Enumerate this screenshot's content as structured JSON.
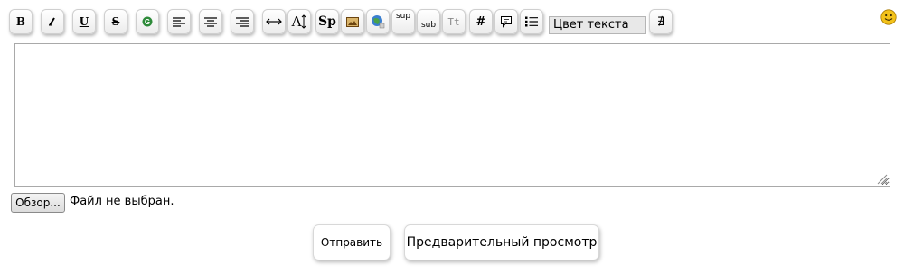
{
  "toolbar": {
    "buttons": [
      {
        "id": "bold",
        "label": "B",
        "icon": "bold-icon"
      },
      {
        "id": "italic",
        "icon": "italic-icon"
      },
      {
        "id": "underline",
        "label": "U",
        "icon": "underline-icon"
      },
      {
        "id": "strike",
        "label": "S",
        "icon": "strikethrough-icon"
      },
      {
        "id": "google",
        "label": "G",
        "icon": "google-icon"
      },
      {
        "id": "align-left",
        "icon": "align-left-icon"
      },
      {
        "id": "align-center",
        "icon": "align-center-icon"
      },
      {
        "id": "align-right",
        "icon": "align-right-icon"
      },
      {
        "id": "justify",
        "icon": "horizontal-arrows-icon"
      },
      {
        "id": "font-size",
        "label": "A",
        "icon": "font-size-icon"
      },
      {
        "id": "spoiler",
        "label": "Sp",
        "icon": "spoiler-icon"
      },
      {
        "id": "image",
        "icon": "image-icon"
      },
      {
        "id": "link",
        "icon": "globe-link-icon"
      },
      {
        "id": "sup",
        "label": "sup",
        "icon": "superscript-icon"
      },
      {
        "id": "sub",
        "label": "sub",
        "icon": "subscript-icon"
      },
      {
        "id": "typewriter",
        "label": "Tt",
        "icon": "typewriter-icon"
      },
      {
        "id": "code",
        "label": "#",
        "icon": "hash-icon"
      },
      {
        "id": "quote",
        "icon": "speech-bubble-icon"
      },
      {
        "id": "list",
        "icon": "bulleted-list-icon"
      }
    ],
    "color_select_value": "Цвет текста",
    "extra_button_label": "∄"
  },
  "editor": {
    "value": ""
  },
  "file": {
    "browse_label": "Обзор...",
    "status": "Файл не выбран."
  },
  "actions": {
    "send_label": "Отправить",
    "preview_label": "Предварительный просмотр"
  },
  "colors": {
    "smiley_fill": "#f3c21a",
    "google_fill": "#2e8b3a",
    "image_fill": "#8a5a1a"
  }
}
